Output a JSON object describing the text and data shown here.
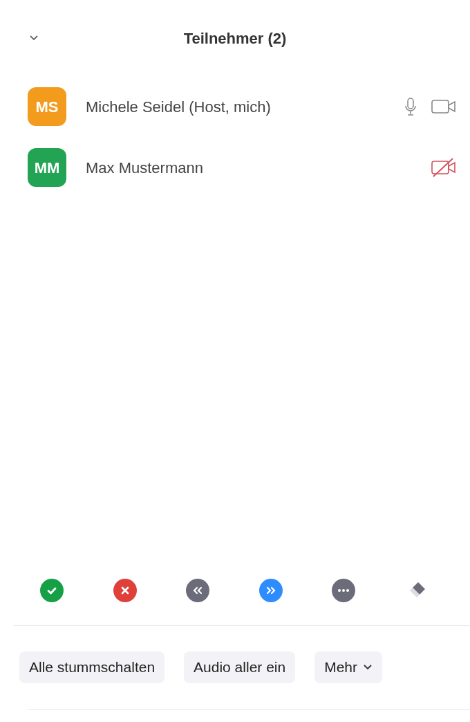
{
  "header": {
    "title": "Teilnehmer (2)"
  },
  "participants": [
    {
      "initials": "MS",
      "name": "Michele Seidel (Host, mich)",
      "color": "#f29b1d",
      "mic": true,
      "video_on": true
    },
    {
      "initials": "MM",
      "name": "Max Mustermann",
      "color": "#22a454",
      "mic": false,
      "video_on": false
    }
  ],
  "reactions": [
    {
      "kind": "yes"
    },
    {
      "kind": "no"
    },
    {
      "kind": "slower"
    },
    {
      "kind": "faster"
    },
    {
      "kind": "more"
    },
    {
      "kind": "clear"
    }
  ],
  "buttons": [
    {
      "label": "Alle stummschalten",
      "dropdown": false
    },
    {
      "label": "Audio aller ein",
      "dropdown": false
    },
    {
      "label": "Mehr",
      "dropdown": true
    }
  ]
}
